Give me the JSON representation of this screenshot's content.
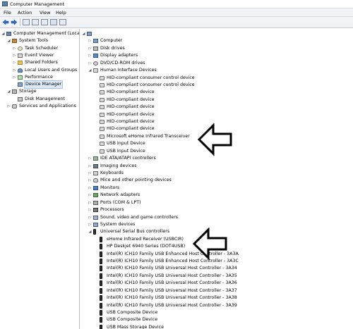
{
  "window": {
    "title": "Computer Management"
  },
  "menu": [
    "File",
    "Action",
    "View",
    "Help"
  ],
  "left_tree": [
    {
      "label": "Computer Management (Local",
      "level": 0,
      "expander": "expanded",
      "icon": "computer-management-icon",
      "icls": "ic-mgmt",
      "selected": false
    },
    {
      "label": "System Tools",
      "level": 1,
      "expander": "expanded",
      "icon": "system-tools-icon",
      "icls": "ic-tools",
      "selected": false
    },
    {
      "label": "Task Scheduler",
      "level": 2,
      "expander": "collapsed",
      "icon": "task-scheduler-icon",
      "icls": "ic-clock",
      "selected": false
    },
    {
      "label": "Event Viewer",
      "level": 2,
      "expander": "collapsed",
      "icon": "event-viewer-icon",
      "icls": "ic-event",
      "selected": false
    },
    {
      "label": "Shared Folders",
      "level": 2,
      "expander": "collapsed",
      "icon": "shared-folders-icon",
      "icls": "ic-folder",
      "selected": false
    },
    {
      "label": "Local Users and Groups",
      "level": 2,
      "expander": "collapsed",
      "icon": "users-icon",
      "icls": "ic-users",
      "selected": false
    },
    {
      "label": "Performance",
      "level": 2,
      "expander": "collapsed",
      "icon": "performance-icon",
      "icls": "ic-perf",
      "selected": false
    },
    {
      "label": "Device Manager",
      "level": 2,
      "expander": "none",
      "icon": "device-manager-icon",
      "icls": "ic-devmgr",
      "selected": true
    },
    {
      "label": "Storage",
      "level": 1,
      "expander": "expanded",
      "icon": "storage-icon",
      "icls": "ic-storage",
      "selected": false
    },
    {
      "label": "Disk Management",
      "level": 2,
      "expander": "none",
      "icon": "disk-management-icon",
      "icls": "ic-disk",
      "selected": false
    },
    {
      "label": "Services and Applications",
      "level": 1,
      "expander": "collapsed",
      "icon": "services-icon",
      "icls": "ic-services",
      "selected": false
    }
  ],
  "device_tree": [
    {
      "label": "",
      "level": 0,
      "expander": "expanded",
      "icon": "computer-root-icon",
      "icls": "ic-comp"
    },
    {
      "label": "Computer",
      "level": 1,
      "expander": "collapsed",
      "icon": "computer-icon",
      "icls": "ic-comp"
    },
    {
      "label": "Disk drives",
      "level": 1,
      "expander": "collapsed",
      "icon": "disk-drive-icon",
      "icls": "ic-drive"
    },
    {
      "label": "Display adapters",
      "level": 1,
      "expander": "collapsed",
      "icon": "display-adapter-icon",
      "icls": "ic-display"
    },
    {
      "label": "DVD/CD-ROM drives",
      "level": 1,
      "expander": "collapsed",
      "icon": "dvd-icon",
      "icls": "ic-dvd"
    },
    {
      "label": "Human Interface Devices",
      "level": 1,
      "expander": "expanded",
      "icon": "hid-icon",
      "icls": "ic-hid"
    },
    {
      "label": "HID-compliant consumer control device",
      "level": 2,
      "expander": "none",
      "icon": "hid-device-icon",
      "icls": "ic-hid"
    },
    {
      "label": "HID-compliant consumer control device",
      "level": 2,
      "expander": "none",
      "icon": "hid-device-icon",
      "icls": "ic-hid"
    },
    {
      "label": "HID-compliant device",
      "level": 2,
      "expander": "none",
      "icon": "hid-device-icon",
      "icls": "ic-hid"
    },
    {
      "label": "HID-compliant device",
      "level": 2,
      "expander": "none",
      "icon": "hid-device-icon",
      "icls": "ic-hid"
    },
    {
      "label": "HID-compliant device",
      "level": 2,
      "expander": "none",
      "icon": "hid-device-icon",
      "icls": "ic-hid"
    },
    {
      "label": "HID-compliant device",
      "level": 2,
      "expander": "none",
      "icon": "hid-device-icon",
      "icls": "ic-hid"
    },
    {
      "label": "HID-compliant device",
      "level": 2,
      "expander": "none",
      "icon": "hid-device-icon",
      "icls": "ic-hid"
    },
    {
      "label": "HID-compliant device",
      "level": 2,
      "expander": "none",
      "icon": "hid-device-icon",
      "icls": "ic-hid"
    },
    {
      "label": "Microsoft eHome Infrared Transceiver",
      "level": 2,
      "expander": "none",
      "icon": "hid-device-icon",
      "icls": "ic-hid"
    },
    {
      "label": "USB Input Device",
      "level": 2,
      "expander": "none",
      "icon": "hid-device-icon",
      "icls": "ic-hid"
    },
    {
      "label": "USB Input Device",
      "level": 2,
      "expander": "none",
      "icon": "hid-device-icon",
      "icls": "ic-hid"
    },
    {
      "label": "IDE ATA/ATAPI controllers",
      "level": 1,
      "expander": "collapsed",
      "icon": "ide-icon",
      "icls": "ic-ide"
    },
    {
      "label": "Imaging devices",
      "level": 1,
      "expander": "collapsed",
      "icon": "imaging-icon",
      "icls": "ic-imaging"
    },
    {
      "label": "Keyboards",
      "level": 1,
      "expander": "collapsed",
      "icon": "keyboard-icon",
      "icls": "ic-keyboard"
    },
    {
      "label": "Mice and other pointing devices",
      "level": 1,
      "expander": "collapsed",
      "icon": "mouse-icon",
      "icls": "ic-mouse"
    },
    {
      "label": "Monitors",
      "level": 1,
      "expander": "collapsed",
      "icon": "monitor-icon",
      "icls": "ic-monitor"
    },
    {
      "label": "Network adapters",
      "level": 1,
      "expander": "collapsed",
      "icon": "network-icon",
      "icls": "ic-network"
    },
    {
      "label": "Ports (COM & LPT)",
      "level": 1,
      "expander": "collapsed",
      "icon": "ports-icon",
      "icls": "ic-ports"
    },
    {
      "label": "Processors",
      "level": 1,
      "expander": "collapsed",
      "icon": "processor-icon",
      "icls": "ic-cpu"
    },
    {
      "label": "Sound, video and game controllers",
      "level": 1,
      "expander": "collapsed",
      "icon": "sound-icon",
      "icls": "ic-sound"
    },
    {
      "label": "System devices",
      "level": 1,
      "expander": "collapsed",
      "icon": "system-devices-icon",
      "icls": "ic-sysdev"
    },
    {
      "label": "Universal Serial Bus controllers",
      "level": 1,
      "expander": "expanded",
      "icon": "usb-icon",
      "icls": "ic-usb"
    },
    {
      "label": "eHome Infrared Receiver (USBCIR)",
      "level": 2,
      "expander": "none",
      "icon": "usb-device-icon",
      "icls": "ic-usb"
    },
    {
      "label": "HP Deskjet 6940 Series (DOT4USB)",
      "level": 2,
      "expander": "none",
      "icon": "usb-device-icon",
      "icls": "ic-usb"
    },
    {
      "label": "Intel(R) ICH10 Family USB Enhanced Host Controller - 3A3A",
      "level": 2,
      "expander": "none",
      "icon": "usb-device-icon",
      "icls": "ic-usb"
    },
    {
      "label": "Intel(R) ICH10 Family USB Enhanced Host Controller - 3A3C",
      "level": 2,
      "expander": "none",
      "icon": "usb-device-icon",
      "icls": "ic-usb"
    },
    {
      "label": "Intel(R) ICH10 Family USB Universal Host Controller - 3A34",
      "level": 2,
      "expander": "none",
      "icon": "usb-device-icon",
      "icls": "ic-usb"
    },
    {
      "label": "Intel(R) ICH10 Family USB Universal Host Controller - 3A35",
      "level": 2,
      "expander": "none",
      "icon": "usb-device-icon",
      "icls": "ic-usb"
    },
    {
      "label": "Intel(R) ICH10 Family USB Universal Host Controller - 3A36",
      "level": 2,
      "expander": "none",
      "icon": "usb-device-icon",
      "icls": "ic-usb"
    },
    {
      "label": "Intel(R) ICH10 Family USB Universal Host Controller - 3A37",
      "level": 2,
      "expander": "none",
      "icon": "usb-device-icon",
      "icls": "ic-usb"
    },
    {
      "label": "Intel(R) ICH10 Family USB Universal Host Controller - 3A38",
      "level": 2,
      "expander": "none",
      "icon": "usb-device-icon",
      "icls": "ic-usb"
    },
    {
      "label": "Intel(R) ICH10 Family USB Universal Host Controller - 3A39",
      "level": 2,
      "expander": "none",
      "icon": "usb-device-icon",
      "icls": "ic-usb"
    },
    {
      "label": "USB Composite Device",
      "level": 2,
      "expander": "none",
      "icon": "usb-device-icon",
      "icls": "ic-usb"
    },
    {
      "label": "USB Composite Device",
      "level": 2,
      "expander": "none",
      "icon": "usb-device-icon",
      "icls": "ic-usb"
    },
    {
      "label": "USB Mass Storage Device",
      "level": 2,
      "expander": "none",
      "icon": "usb-device-icon",
      "icls": "ic-usb"
    }
  ]
}
